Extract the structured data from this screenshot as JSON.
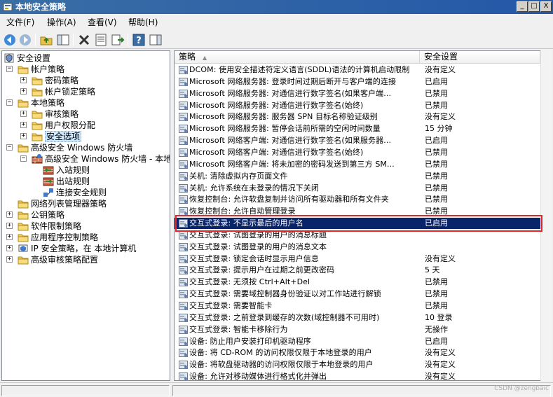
{
  "window": {
    "title": "本地安全策略",
    "btn_min": "_",
    "btn_max": "□",
    "btn_close": "X"
  },
  "menu": {
    "file": "文件(F)",
    "action": "操作(A)",
    "view": "查看(V)",
    "help": "帮助(H)"
  },
  "tree": [
    {
      "label": "安全设置",
      "icon": "security-settings-icon"
    },
    {
      "label": "帐户策略",
      "icon": "folder-icon",
      "expander": "−"
    },
    {
      "label": "密码策略",
      "icon": "folder-icon",
      "expander": "+"
    },
    {
      "label": "帐户锁定策略",
      "icon": "folder-icon",
      "expander": "+"
    },
    {
      "label": "本地策略",
      "icon": "folder-icon",
      "expander": "−"
    },
    {
      "label": "审核策略",
      "icon": "folder-icon",
      "expander": "+"
    },
    {
      "label": "用户权限分配",
      "icon": "folder-icon",
      "expander": "+"
    },
    {
      "label": "安全选项",
      "icon": "folder-icon",
      "expander": "+"
    },
    {
      "label": "高级安全 Windows 防火墙",
      "icon": "folder-icon",
      "expander": "−"
    },
    {
      "label": "高级安全 Windows 防火墙 - 本地",
      "icon": "firewall-icon",
      "expander": "−"
    },
    {
      "label": "入站规则",
      "icon": "inbound-rules-icon"
    },
    {
      "label": "出站规则",
      "icon": "outbound-rules-icon"
    },
    {
      "label": "连接安全规则",
      "icon": "connection-security-icon"
    },
    {
      "label": "网络列表管理器策略",
      "icon": "folder-icon"
    },
    {
      "label": "公钥策略",
      "icon": "folder-icon",
      "expander": "+"
    },
    {
      "label": "软件限制策略",
      "icon": "folder-icon",
      "expander": "+"
    },
    {
      "label": "应用程序控制策略",
      "icon": "folder-icon",
      "expander": "+"
    },
    {
      "label": "IP 安全策略，在 本地计算机",
      "icon": "ip-security-icon",
      "expander": "+"
    },
    {
      "label": "高级审核策略配置",
      "icon": "folder-icon",
      "expander": "+"
    }
  ],
  "list": {
    "col_policy": "策略",
    "col_setting": "安全设置",
    "rows": [
      {
        "name": "DCOM: 使用安全描述符定义语言(SDDL)语法的计算机启动限制",
        "setting": "没有定义"
      },
      {
        "name": "Microsoft 网络服务器: 登录时间过期后断开与客户端的连接",
        "setting": "已启用"
      },
      {
        "name": "Microsoft 网络服务器: 对通信进行数字签名(如果客户端...",
        "setting": "已禁用"
      },
      {
        "name": "Microsoft 网络服务器: 对通信进行数字签名(始终)",
        "setting": "已禁用"
      },
      {
        "name": "Microsoft 网络服务器: 服务器 SPN 目标名称验证级别",
        "setting": "没有定义"
      },
      {
        "name": "Microsoft 网络服务器: 暂停会话前所需的空闲时间数量",
        "setting": "15 分钟"
      },
      {
        "name": "Microsoft 网络客户端: 对通信进行数字签名(如果服务器...",
        "setting": "已启用"
      },
      {
        "name": "Microsoft 网络客户端: 对通信进行数字签名(始终)",
        "setting": "已禁用"
      },
      {
        "name": "Microsoft 网络客户端: 将未加密的密码发送到第三方 SM...",
        "setting": "已禁用"
      },
      {
        "name": "关机: 清除虚拟内存页面文件",
        "setting": "已禁用"
      },
      {
        "name": "关机: 允许系统在未登录的情况下关闭",
        "setting": "已禁用"
      },
      {
        "name": "恢复控制台: 允许软盘复制并访问所有驱动器和所有文件夹",
        "setting": "已禁用"
      },
      {
        "name": "恢复控制台: 允许自动管理登录",
        "setting": "已禁用"
      },
      {
        "name": "交互式登录: 不显示最后的用户名",
        "setting": "已启用",
        "selected": true
      },
      {
        "name": "交互式登录: 试图登录的用户的消息标题",
        "setting": ""
      },
      {
        "name": "交互式登录: 试图登录的用户的消息文本",
        "setting": ""
      },
      {
        "name": "交互式登录: 锁定会话时显示用户信息",
        "setting": "没有定义"
      },
      {
        "name": "交互式登录: 提示用户在过期之前更改密码",
        "setting": "5 天"
      },
      {
        "name": "交互式登录: 无须按 Ctrl+Alt+Del",
        "setting": "已禁用"
      },
      {
        "name": "交互式登录: 需要域控制器身份验证以对工作站进行解锁",
        "setting": "已禁用"
      },
      {
        "name": "交互式登录: 需要智能卡",
        "setting": "已禁用"
      },
      {
        "name": "交互式登录: 之前登录到缓存的次数(域控制器不可用时)",
        "setting": "10 登录"
      },
      {
        "name": "交互式登录: 智能卡移除行为",
        "setting": "无操作"
      },
      {
        "name": "设备: 防止用户安装打印机驱动程序",
        "setting": "已启用"
      },
      {
        "name": "设备: 将 CD-ROM 的访问权限仅限于本地登录的用户",
        "setting": "没有定义"
      },
      {
        "name": "设备: 将软盘驱动器的访问权限仅限于本地登录的用户",
        "setting": "没有定义"
      },
      {
        "name": "设备: 允许对移动媒体进行格式化并弹出",
        "setting": "没有定义"
      }
    ]
  },
  "watermark": "CSDN @zengbaic"
}
